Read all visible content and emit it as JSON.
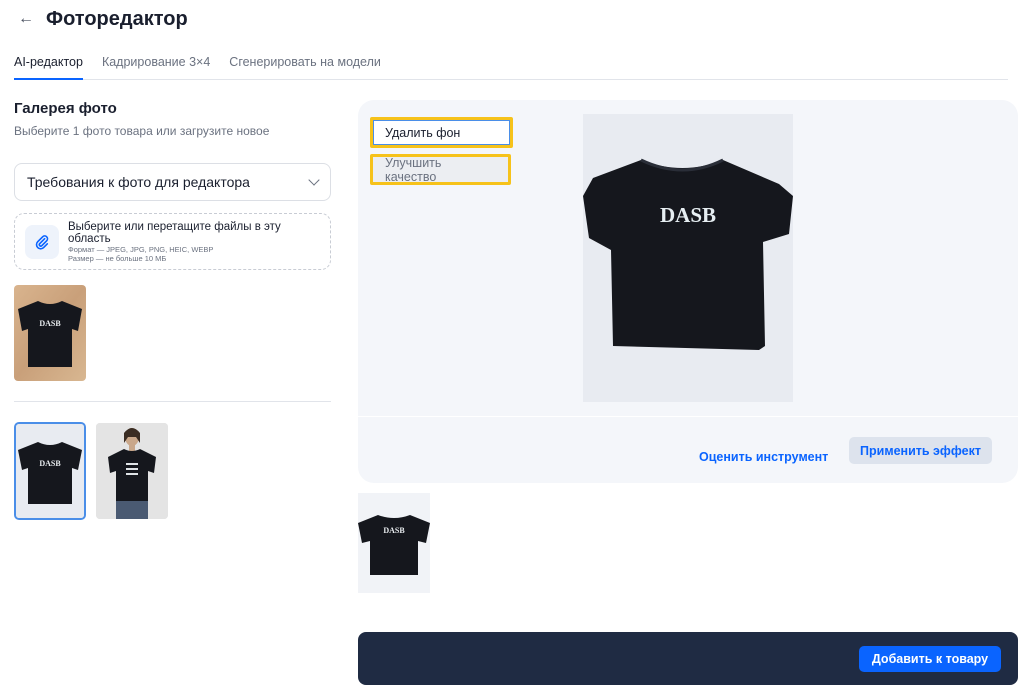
{
  "header": {
    "back_icon": "arrow-left-icon",
    "title": "Фоторедактор"
  },
  "tabs": [
    {
      "label": "AI-редактор",
      "active": true
    },
    {
      "label": "Кадрирование 3×4",
      "active": false
    },
    {
      "label": "Сгенерировать на модели",
      "active": false
    }
  ],
  "gallery": {
    "title": "Галерея фото",
    "subtitle": "Выберите 1 фото товара или загрузите новое",
    "requirements_label": "Требования к фото для редактора",
    "upload": {
      "icon": "paperclip-icon",
      "main": "Выберите или перетащите файлы в эту область",
      "format_hint": "Формат — JPEG, JPG, PNG, HEIC, WEBP",
      "size_hint": "Размер — не больше 10 МБ"
    },
    "shirt_text": "DASB"
  },
  "editor": {
    "remove_bg_label": "Удалить фон",
    "enhance_label": "Улучшить качество",
    "rate_label": "Оценить инструмент",
    "apply_label": "Применить эффект"
  },
  "footer": {
    "add_label": "Добавить к товару"
  },
  "colors": {
    "accent": "#0a64ff",
    "highlight": "#f6c21a",
    "dark_bar": "#1f2b43"
  }
}
